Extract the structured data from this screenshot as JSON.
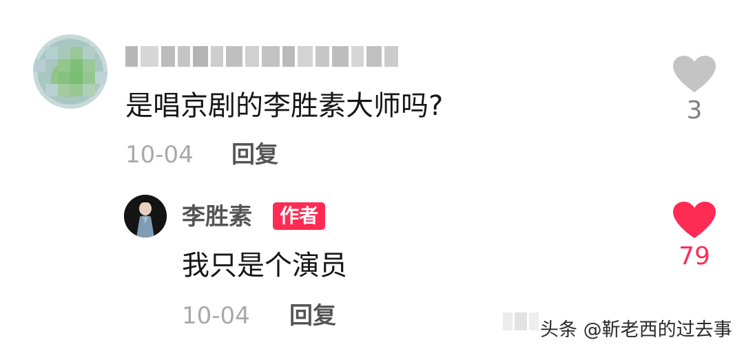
{
  "comment": {
    "text": "是唱京剧的李胜素大师吗?",
    "date": "10-04",
    "reply_label": "回复",
    "like_count": "3",
    "like_icon": "heart-icon-gray",
    "username_blurred": true
  },
  "reply": {
    "username": "李胜素",
    "badge": "作者",
    "text": "我只是个演员",
    "date": "10-04",
    "reply_label": "回复",
    "like_count": "79",
    "like_icon": "heart-icon-red"
  },
  "watermark": "头条 @靳老西的过去事",
  "colors": {
    "accent": "#fe2c55",
    "like_inactive": "#c4c4c4",
    "muted_text": "#a9a9a9",
    "secondary_text": "#555555"
  }
}
